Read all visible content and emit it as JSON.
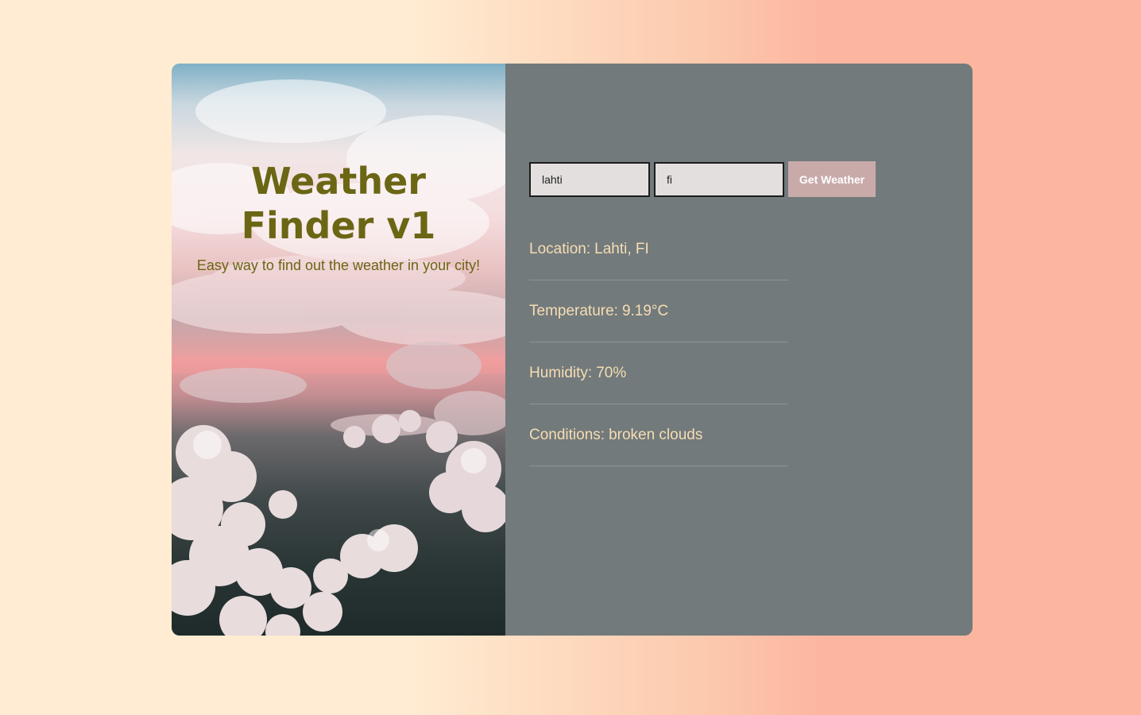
{
  "hero": {
    "title": "Weather Finder v1",
    "subtitle": "Easy way to find out the weather in your city!"
  },
  "form": {
    "city_value": "lahti",
    "country_value": "fi",
    "button_label": "Get Weather"
  },
  "results": [
    {
      "label": "Location:",
      "value": "Lahti, FI"
    },
    {
      "label": "Temperature:",
      "value": "9.19°C"
    },
    {
      "label": "Humidity:",
      "value": "70%"
    },
    {
      "label": "Conditions:",
      "value": "broken clouds"
    }
  ],
  "colors": {
    "page_gradient_left": "#ffecd2",
    "page_gradient_right": "#fcb69f",
    "panel_bg": "#727a7c",
    "result_text": "#f7ddb2",
    "title_text": "#6b6614",
    "button_bg": "#c8aba9",
    "input_bg": "#e3dfdf"
  }
}
